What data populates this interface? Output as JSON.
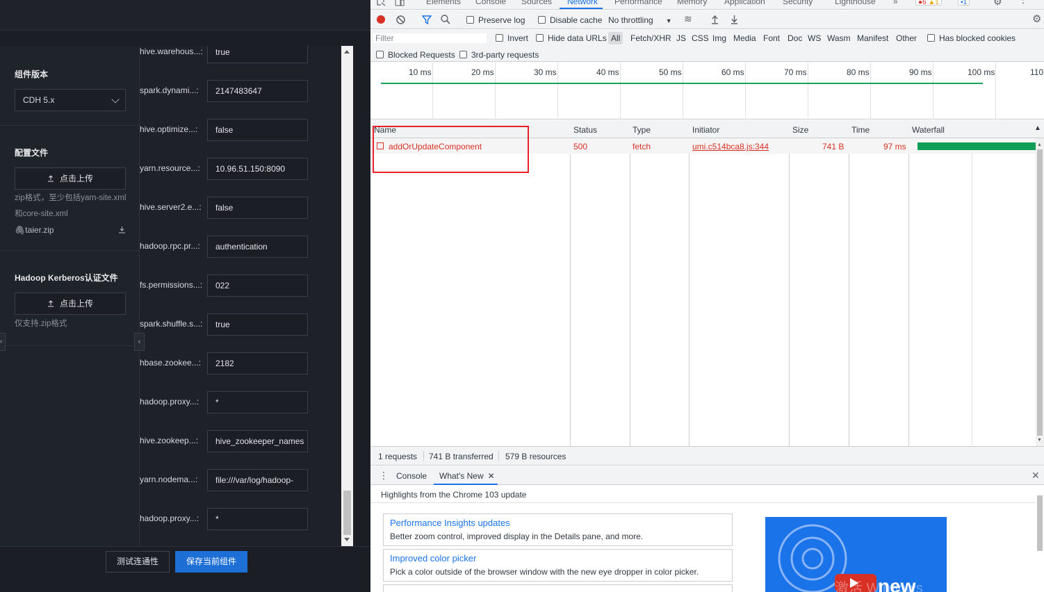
{
  "app": {
    "sidebar": {
      "version_title": "组件版本",
      "version_value": "CDH 5.x",
      "config_title": "配置文件",
      "upload_label": "点击上传",
      "config_hint": "zip格式，至少包括yarn-site.xml和core-site.xml",
      "config_file": "taier.zip",
      "kerberos_title": "Hadoop Kerberos认证文件",
      "kerberos_upload_label": "点击上传",
      "kerberos_hint": "仅支持.zip格式"
    },
    "form_rows": [
      {
        "label": "hive.warehous...:",
        "value": "true"
      },
      {
        "label": "spark.dynami...:",
        "value": "2147483647"
      },
      {
        "label": "hive.optimize...:",
        "value": "false"
      },
      {
        "label": "yarn.resource...:",
        "value": "10.96.51.150:8090"
      },
      {
        "label": "hive.server2.e...:",
        "value": "false"
      },
      {
        "label": "hadoop.rpc.pr...:",
        "value": "authentication"
      },
      {
        "label": "fs.permissions...:",
        "value": "022"
      },
      {
        "label": "spark.shuffle.s...:",
        "value": "true"
      },
      {
        "label": "hbase.zookee...:",
        "value": "2182"
      },
      {
        "label": "hadoop.proxy...:",
        "value": "*"
      },
      {
        "label": "hive.zookeep...:",
        "value": "hive_zookeeper_names"
      },
      {
        "label": "yarn.nodema...:",
        "value": "file:///var/log/hadoop-"
      },
      {
        "label": "hadoop.proxy...:",
        "value": "*"
      }
    ],
    "footer": {
      "test_label": "测试连通性",
      "save_label": "保存当前组件"
    }
  },
  "devtools": {
    "tabs": [
      "Elements",
      "Console",
      "Sources",
      "Network",
      "Performance",
      "Memory",
      "Application",
      "Security",
      "Lighthouse"
    ],
    "active_tab": "Network",
    "badges": {
      "errors": "6",
      "warnings": "1",
      "messages": "1"
    },
    "toolbar": {
      "preserve_log": "Preserve log",
      "disable_cache": "Disable cache",
      "throttling": "No throttling"
    },
    "filter": {
      "placeholder": "Filter",
      "invert": "Invert",
      "hide_data_urls": "Hide data URLs",
      "types": [
        "All",
        "Fetch/XHR",
        "JS",
        "CSS",
        "Img",
        "Media",
        "Font",
        "Doc",
        "WS",
        "Wasm",
        "Manifest",
        "Other"
      ],
      "has_blocked_cookies": "Has blocked cookies",
      "blocked_requests": "Blocked Requests",
      "third_party": "3rd-party requests"
    },
    "overview_ticks": [
      "10 ms",
      "20 ms",
      "30 ms",
      "40 ms",
      "50 ms",
      "60 ms",
      "70 ms",
      "80 ms",
      "90 ms",
      "100 ms",
      "110"
    ],
    "columns": [
      "Name",
      "Status",
      "Type",
      "Initiator",
      "Size",
      "Time",
      "Waterfall"
    ],
    "request": {
      "name": "addOrUpdateComponent",
      "status": "500",
      "type": "fetch",
      "initiator": "umi.c514bca8.js:344",
      "size": "741 B",
      "time": "97 ms"
    },
    "summary": {
      "requests": "1 requests",
      "transferred": "741 B transferred",
      "resources": "579 B resources"
    },
    "drawer": {
      "tab_console": "Console",
      "tab_whats_new": "What's New",
      "heading": "Highlights from the Chrome 103 update",
      "cards": [
        {
          "title": "Performance Insights updates",
          "desc": "Better zoom control, improved display in the Details pane, and more."
        },
        {
          "title": "Improved color picker",
          "desc": "Pick a color outside of the browser window with the new eye dropper in color picker."
        }
      ],
      "promo_text": "new",
      "watermark": "激活 Windows"
    }
  },
  "colors": {
    "brand_blue": "#1d6fd6",
    "error_red": "#d93025",
    "devtools_blue": "#1a73e8",
    "waterfall_green": "#0f9d58"
  }
}
